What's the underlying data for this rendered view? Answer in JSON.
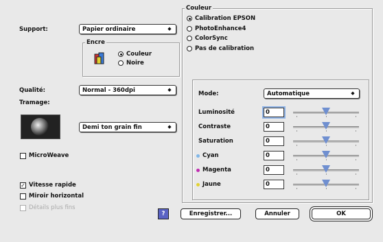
{
  "left": {
    "support_label": "Support:",
    "support_value": "Papier ordinaire",
    "ink_group_title": "Encre",
    "ink_options": [
      "Couleur",
      "Noire"
    ],
    "quality_label": "Qualité:",
    "quality_value": "Normal - 360dpi",
    "dither_label": "Tramage:",
    "dither_value": "Demi ton grain fin",
    "microweave_label": "MicroWeave",
    "fast_label": "Vitesse rapide",
    "mirror_label": "Miroir horizontal",
    "finer_label": "Détails plus fins"
  },
  "color": {
    "group_title": "Couleur",
    "options": [
      "Calibration EPSON",
      "PhotoEnhance4",
      "ColorSync",
      "Pas de calibration"
    ],
    "selected": 0,
    "mode_label": "Mode:",
    "mode_value": "Automatique",
    "adjust": [
      {
        "label": "Luminosité",
        "value": "0",
        "dot": ""
      },
      {
        "label": "Contraste",
        "value": "0",
        "dot": ""
      },
      {
        "label": "Saturation",
        "value": "0",
        "dot": ""
      },
      {
        "label": "Cyan",
        "value": "0",
        "dot": "#7fb6e8"
      },
      {
        "label": "Magenta",
        "value": "0",
        "dot": "#c02ab0"
      },
      {
        "label": "Jaune",
        "value": "0",
        "dot": "#e2d230"
      }
    ],
    "slider_levels": [
      0.5,
      0.5,
      0.5,
      0.5,
      0.5,
      0.5
    ]
  },
  "buttons": {
    "help": "?",
    "save": "Enregistrer...",
    "cancel": "Annuler",
    "ok": "OK"
  },
  "colors": {
    "help_bg": "#5a63c4",
    "thumb": "#6f8fd0"
  }
}
